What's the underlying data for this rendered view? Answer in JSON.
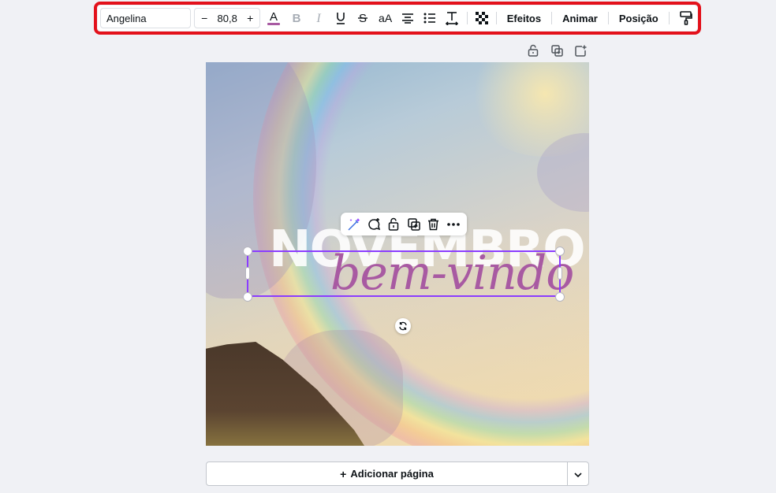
{
  "toolbar": {
    "font_name": "Angelina",
    "size_decrease": "−",
    "font_size": "80,8",
    "size_increase": "+",
    "case_label": "aA",
    "effects_label": "Efeitos",
    "animate_label": "Animar",
    "position_label": "Posição",
    "text_color": "#a85aa2",
    "icons": [
      "text-color-icon",
      "bold-icon",
      "italic-icon",
      "underline-icon",
      "strikethrough-icon",
      "letter-case-icon",
      "align-center-icon",
      "list-icon",
      "spacing-icon",
      "transparency-icon",
      "copy-style-icon"
    ]
  },
  "page_actions": {
    "icons": [
      "lock-icon",
      "duplicate-page-icon",
      "add-page-icon"
    ]
  },
  "canvas": {
    "heading_text": "NOVEMBRO",
    "script_text": "bem-vindo",
    "selection_color": "#8b3dff"
  },
  "context_menu": {
    "icons": [
      "magic-write-icon",
      "comment-icon",
      "lock-icon",
      "duplicate-icon",
      "delete-icon",
      "more-icon"
    ]
  },
  "add_page": {
    "label": "Adicionar página",
    "plus": "+"
  }
}
